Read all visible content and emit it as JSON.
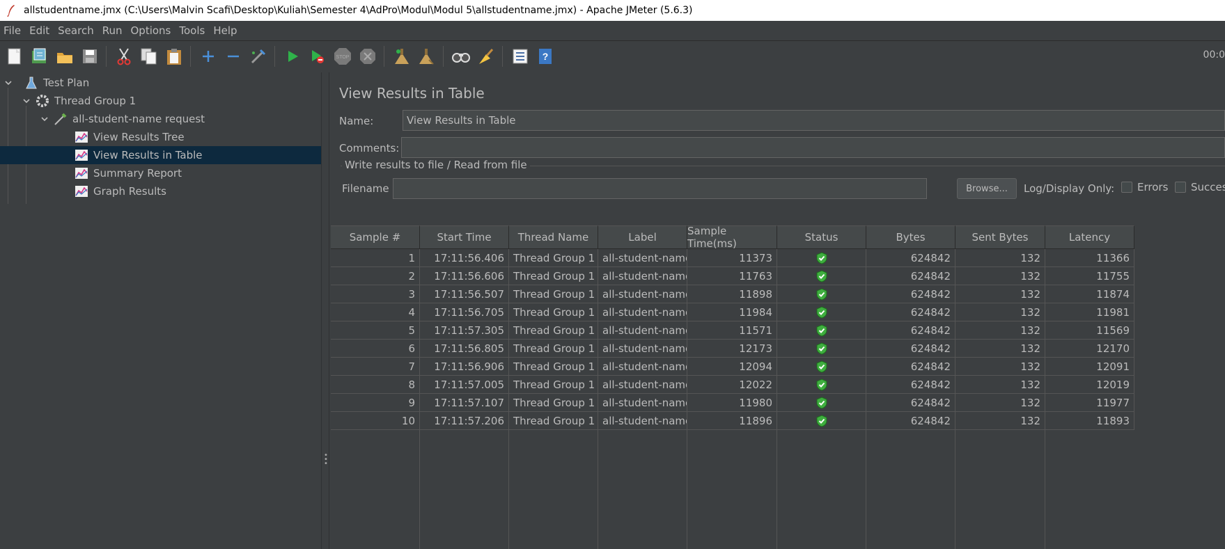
{
  "window": {
    "title": "allstudentname.jmx (C:\\Users\\Malvin Scafi\\Desktop\\Kuliah\\Semester 4\\AdPro\\Modul\\Modul 5\\allstudentname.jmx) - Apache JMeter (5.6.3)"
  },
  "menu": [
    "File",
    "Edit",
    "Search",
    "Run",
    "Options",
    "Tools",
    "Help"
  ],
  "toolbar": {
    "icons": [
      "new-icon",
      "templates-icon",
      "open-icon",
      "save-icon",
      "cut-icon",
      "copy-icon",
      "paste-icon",
      "expand-icon",
      "collapse-icon",
      "toggle-icon",
      "start-icon",
      "start-no-pauses-icon",
      "stop-icon",
      "shutdown-icon",
      "clear-icon",
      "clear-all-icon",
      "search-icon",
      "reset-search-icon",
      "function-helper-icon",
      "help-icon"
    ],
    "timer": "00:0"
  },
  "tree": {
    "items": [
      {
        "label": "Test Plan",
        "icon": "flask-icon"
      },
      {
        "label": "Thread Group 1",
        "icon": "gear-icon"
      },
      {
        "label": "all-student-name request",
        "icon": "pipette-icon"
      },
      {
        "label": "View Results Tree",
        "icon": "chart-icon"
      },
      {
        "label": "View Results in Table",
        "icon": "chart-icon"
      },
      {
        "label": "Summary Report",
        "icon": "chart-icon"
      },
      {
        "label": "Graph Results",
        "icon": "chart-icon"
      }
    ],
    "selected_index": 4
  },
  "panel": {
    "title": "View Results in Table",
    "name_label": "Name:",
    "name_value": "View Results in Table",
    "comments_label": "Comments:",
    "comments_value": "",
    "group_title": "Write results to file / Read from file",
    "filename_label": "Filename",
    "filename_value": "",
    "browse_label": "Browse...",
    "log_display_label": "Log/Display Only:",
    "errors_label": "Errors",
    "successes_label": "Succes"
  },
  "table": {
    "columns": [
      "Sample #",
      "Start Time",
      "Thread Name",
      "Label",
      "Sample Time(ms)",
      "Status",
      "Bytes",
      "Sent Bytes",
      "Latency"
    ],
    "rows": [
      [
        "1",
        "17:11:56.406",
        "Thread Group 1 ...",
        "all-student-name...",
        "11373",
        "success",
        "624842",
        "132",
        "11366"
      ],
      [
        "2",
        "17:11:56.606",
        "Thread Group 1 ...",
        "all-student-name...",
        "11763",
        "success",
        "624842",
        "132",
        "11755"
      ],
      [
        "3",
        "17:11:56.507",
        "Thread Group 1 ...",
        "all-student-name...",
        "11898",
        "success",
        "624842",
        "132",
        "11874"
      ],
      [
        "4",
        "17:11:56.705",
        "Thread Group 1 ...",
        "all-student-name...",
        "11984",
        "success",
        "624842",
        "132",
        "11981"
      ],
      [
        "5",
        "17:11:57.305",
        "Thread Group 1 ...",
        "all-student-name...",
        "11571",
        "success",
        "624842",
        "132",
        "11569"
      ],
      [
        "6",
        "17:11:56.805",
        "Thread Group 1 ...",
        "all-student-name...",
        "12173",
        "success",
        "624842",
        "132",
        "12170"
      ],
      [
        "7",
        "17:11:56.906",
        "Thread Group 1 ...",
        "all-student-name...",
        "12094",
        "success",
        "624842",
        "132",
        "12091"
      ],
      [
        "8",
        "17:11:57.005",
        "Thread Group 1 ...",
        "all-student-name...",
        "12022",
        "success",
        "624842",
        "132",
        "12019"
      ],
      [
        "9",
        "17:11:57.107",
        "Thread Group 1 ...",
        "all-student-name...",
        "11980",
        "success",
        "624842",
        "132",
        "11977"
      ],
      [
        "10",
        "17:11:57.206",
        "Thread Group 1 ...",
        "all-student-name...",
        "11896",
        "success",
        "624842",
        "132",
        "11893"
      ]
    ]
  },
  "colors": {
    "background": "#3c3f41",
    "selection": "#0d293e",
    "text": "#bbbbbb",
    "status_ok": "#3fae3f"
  }
}
